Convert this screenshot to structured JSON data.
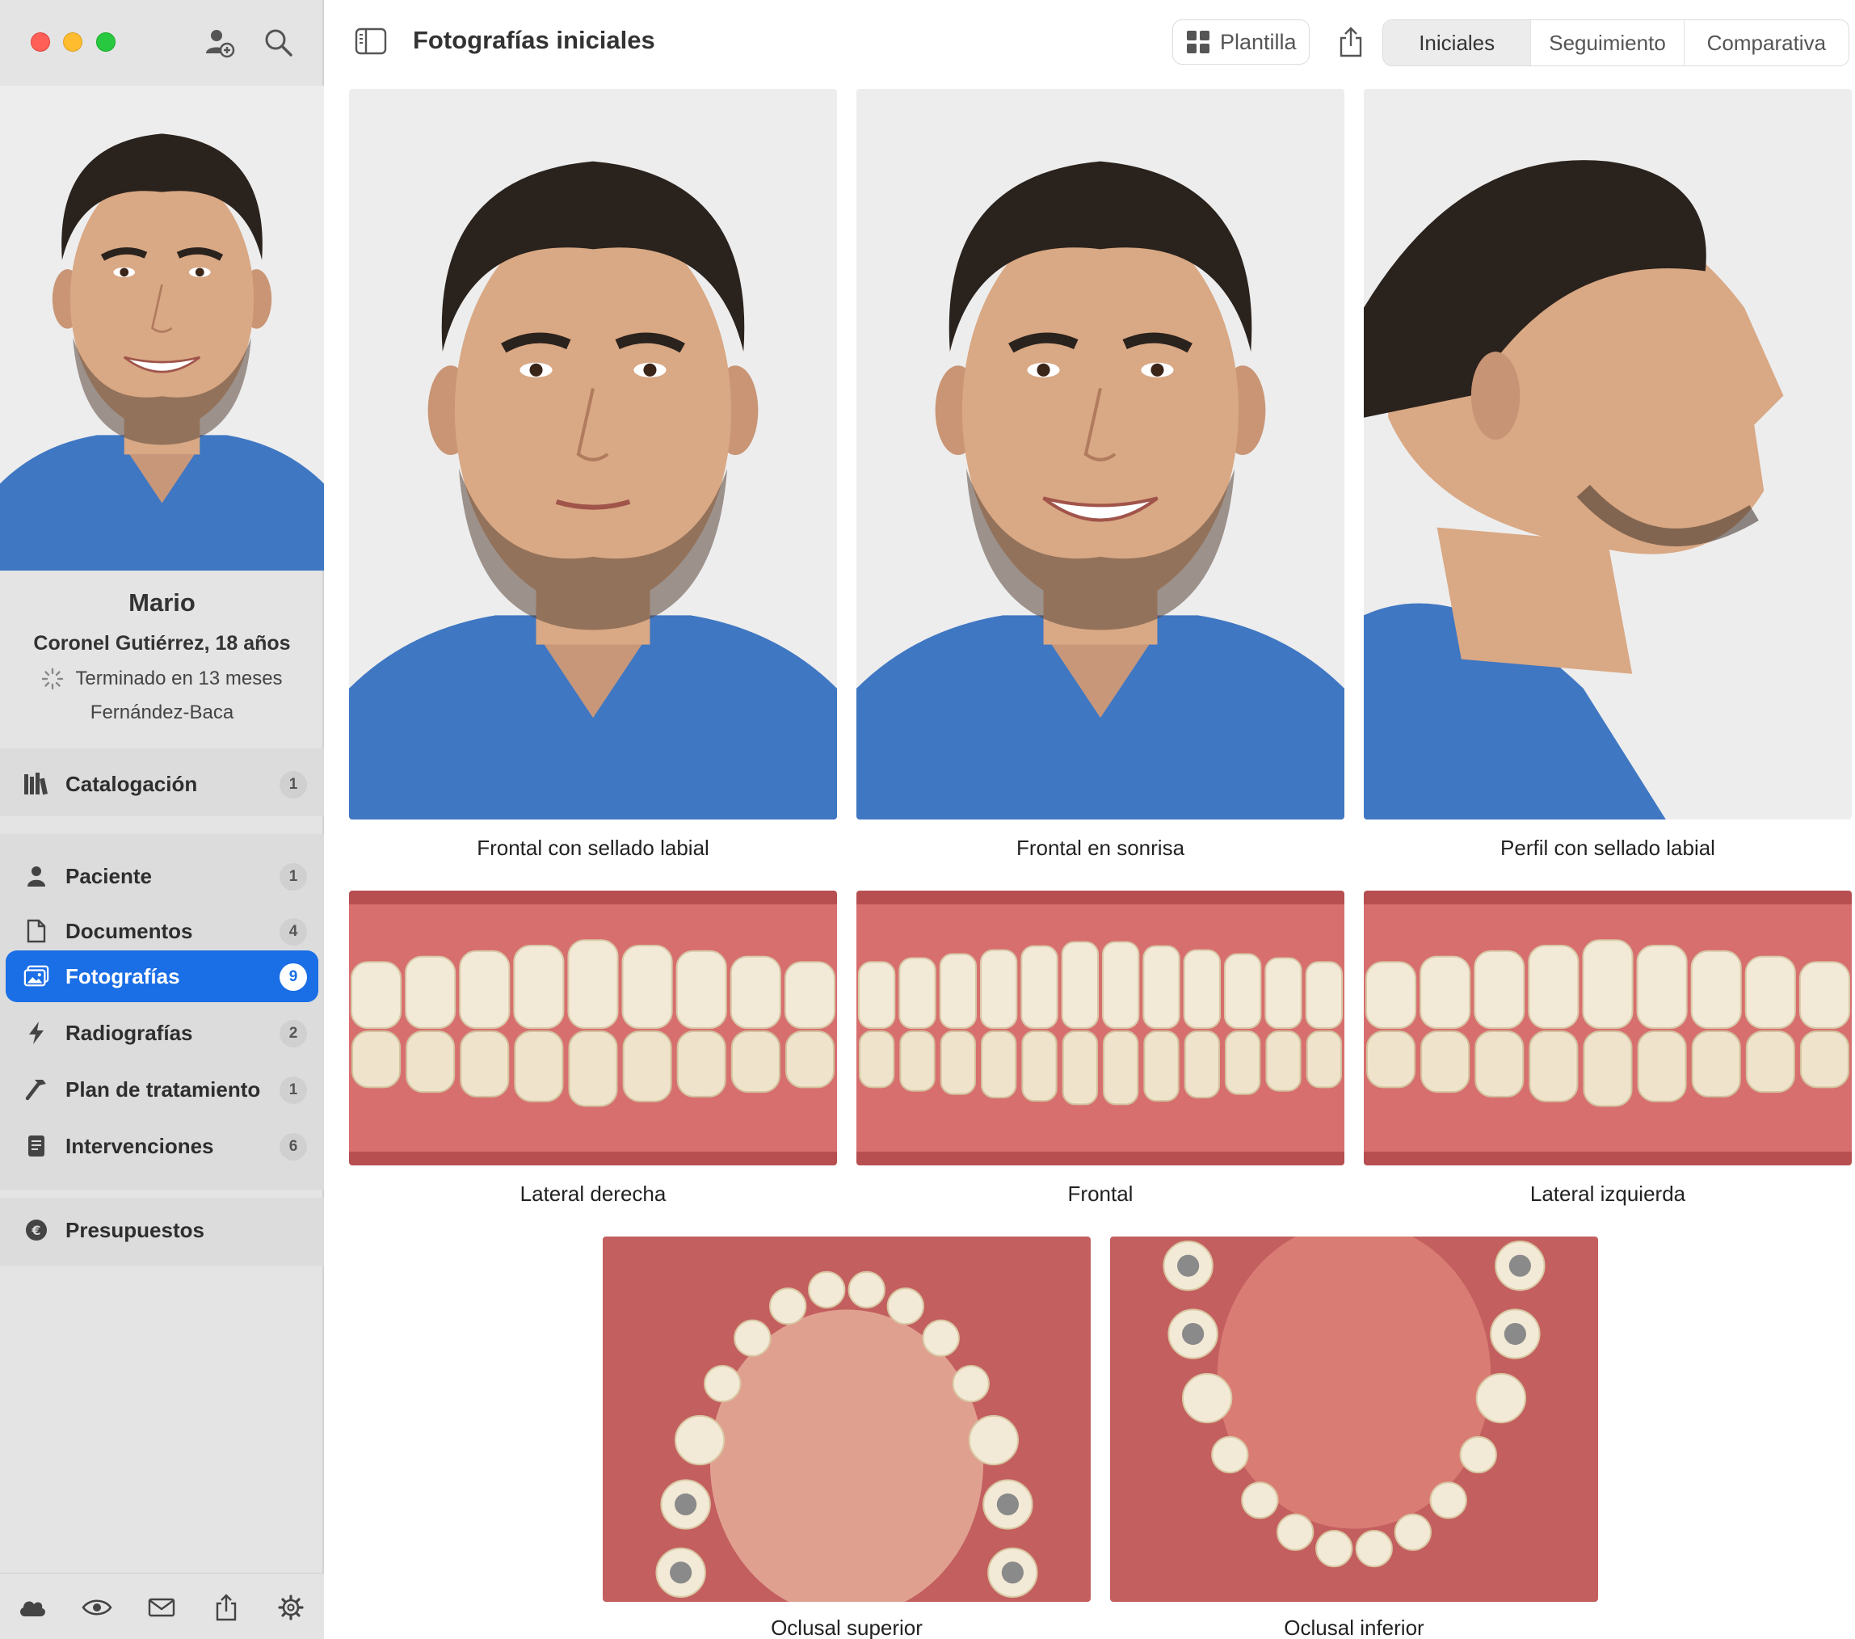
{
  "window": {
    "title": "Fotografías iniciales"
  },
  "toolbar": {
    "template_label": "Plantilla",
    "segments": [
      "Iniciales",
      "Seguimiento",
      "Comparativa"
    ],
    "active_segment": "Iniciales"
  },
  "patient": {
    "first_name": "Mario",
    "surname_age": "Coronel Gutiérrez, 18 años",
    "status": "Terminado en 13 meses",
    "doctor": "Fernández-Baca"
  },
  "sidebar": {
    "catalog": {
      "label": "Catalogación",
      "count": "1",
      "icon": "books-icon"
    },
    "items": [
      {
        "label": "Paciente",
        "count": "1",
        "icon": "person-icon"
      },
      {
        "label": "Documentos",
        "count": "4",
        "icon": "document-icon"
      },
      {
        "label": "Fotografías",
        "count": "9",
        "icon": "photos-icon",
        "active": true
      },
      {
        "label": "Radiografías",
        "count": "2",
        "icon": "bolt-icon"
      },
      {
        "label": "Plan de tratamiento",
        "count": "1",
        "icon": "hammer-icon"
      },
      {
        "label": "Intervenciones",
        "count": "6",
        "icon": "notepad-icon"
      }
    ],
    "budget": {
      "label": "Presupuestos",
      "icon": "euro-icon"
    },
    "bottom_icons": [
      "cloud-icon",
      "eye-icon",
      "mail-icon",
      "export-icon",
      "gear-icon"
    ]
  },
  "photos": [
    {
      "caption": "Frontal con sellado labial",
      "kind": "face-front"
    },
    {
      "caption": "Frontal en sonrisa",
      "kind": "face-smile"
    },
    {
      "caption": "Perfil con sellado labial",
      "kind": "face-profile"
    },
    {
      "caption": "Lateral derecha",
      "kind": "teeth-lateral"
    },
    {
      "caption": "Frontal",
      "kind": "teeth-front"
    },
    {
      "caption": "Lateral izquierda",
      "kind": "teeth-lateral"
    },
    {
      "caption": "Oclusal superior",
      "kind": "occlusal-upper"
    },
    {
      "caption": "Oclusal inferior",
      "kind": "occlusal-lower"
    }
  ],
  "colors": {
    "accent": "#1a6ee6",
    "shirt": "#3f77c2",
    "skin": "#d9a884",
    "hair": "#2a221d",
    "gum": "#d76f6f",
    "tooth": "#f2ead6"
  }
}
